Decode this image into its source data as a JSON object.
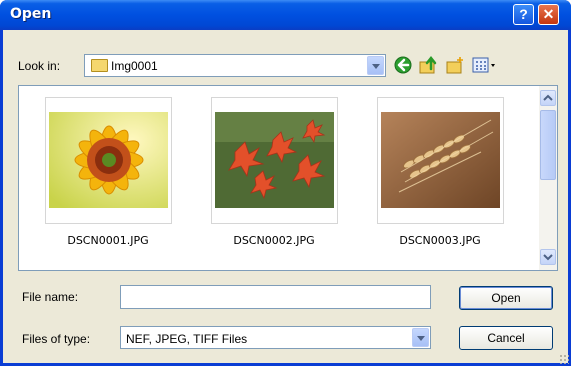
{
  "window": {
    "title": "Open",
    "help_glyph": "?",
    "close_glyph": "✕"
  },
  "lookin": {
    "label": "Look in:",
    "value": "Img0001"
  },
  "toolbar": {
    "icons": [
      "back-icon",
      "up-folder-icon",
      "new-folder-icon",
      "views-menu-icon"
    ]
  },
  "files": [
    {
      "name": "DSCN0001.JPG",
      "thumbnail": "sunflower"
    },
    {
      "name": "DSCN0002.JPG",
      "thumbnail": "orange-lilies"
    },
    {
      "name": "DSCN0003.JPG",
      "thumbnail": "wheat"
    }
  ],
  "filename": {
    "label": "File name:",
    "value": ""
  },
  "filetype": {
    "label": "Files of type:",
    "value": "NEF, JPEG, TIFF Files"
  },
  "buttons": {
    "open": "Open",
    "cancel": "Cancel"
  },
  "colors": {
    "titlebar": "#0050e0",
    "dialog_bg": "#ece9d8",
    "close_button": "#c4360f"
  }
}
